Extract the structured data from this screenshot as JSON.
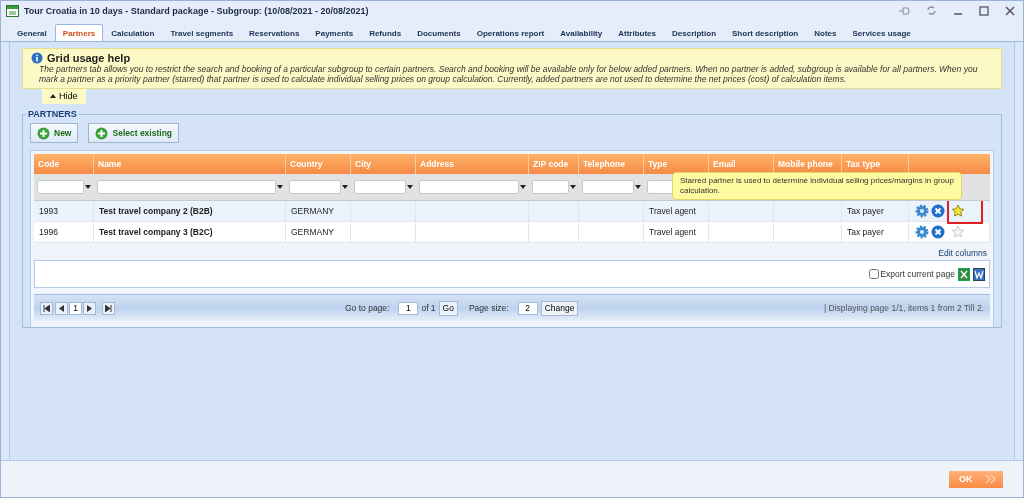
{
  "window": {
    "title": "Tour Croatia in 10 days - Standard package - Subgroup: (10/08/2021 - 20/08/2021)"
  },
  "tabs": [
    {
      "label": "General",
      "selected": false
    },
    {
      "label": "Partners",
      "selected": true
    },
    {
      "label": "Calculation",
      "selected": false
    },
    {
      "label": "Travel segments",
      "selected": false
    },
    {
      "label": "Reservations",
      "selected": false
    },
    {
      "label": "Payments",
      "selected": false
    },
    {
      "label": "Refunds",
      "selected": false
    },
    {
      "label": "Documents",
      "selected": false
    },
    {
      "label": "Operations report",
      "selected": false
    },
    {
      "label": "Availability",
      "selected": false
    },
    {
      "label": "Attributes",
      "selected": false
    },
    {
      "label": "Description",
      "selected": false
    },
    {
      "label": "Short description",
      "selected": false
    },
    {
      "label": "Notes",
      "selected": false
    },
    {
      "label": "Services usage",
      "selected": false
    }
  ],
  "help": {
    "title": "Grid usage help",
    "text": "The partners tab allows you to restrict the search and booking of a particular subgroup to certain partners. Search and booking will be available only for below added partners. When no partner is added, subgroup is available for all partners. When you mark a partner as a priority partner (starred) that partner is used to calculate individual selling prices on group calculation. Currently, added partners are not used to determine the net prices (cost) of calculation items.",
    "hide": "Hide"
  },
  "partners": {
    "legend": "PARTNERS",
    "buttons": [
      "New",
      "Select existing"
    ],
    "columns": [
      {
        "label": "Code",
        "filter": true
      },
      {
        "label": "Name",
        "filter": true
      },
      {
        "label": "Country",
        "filter": true
      },
      {
        "label": "City",
        "filter": true
      },
      {
        "label": "Address",
        "filter": true
      },
      {
        "label": "ZIP code",
        "filter": true
      },
      {
        "label": "Telephone",
        "filter": true
      },
      {
        "label": "Type",
        "filter": true
      },
      {
        "label": "Email",
        "filter": false
      },
      {
        "label": "Mobile phone",
        "filter": false
      },
      {
        "label": "Tax type",
        "filter": false
      }
    ],
    "tooltip": "Starred partner is used to determine individual selling prices/margins in group calculation.",
    "rows": [
      {
        "cells": [
          "1993",
          "Test travel company 2 (B2B)",
          "GERMANY",
          "",
          "",
          "",
          "",
          "Travel agent",
          "",
          "",
          "Tax payer"
        ],
        "selected": true,
        "starred": true,
        "highlighted": true
      },
      {
        "cells": [
          "1996",
          "Test travel company 3 (B2C)",
          "GERMANY",
          "",
          "",
          "",
          "",
          "Travel agent",
          "",
          "",
          "Tax payer"
        ],
        "selected": false,
        "starred": false,
        "highlighted": false
      }
    ],
    "edit_columns": "Edit columns",
    "export_label": "Export current page",
    "export_checked": false,
    "pager": {
      "page": "1",
      "goto_label": "Go to page:",
      "goto_value": "1",
      "of": "of 1",
      "go": "Go",
      "size_label": "Page size:",
      "size_value": "2",
      "change": "Change",
      "status": "| Displaying page  1/1,  items  1  from  2  Till  2."
    }
  },
  "ok": "OK"
}
